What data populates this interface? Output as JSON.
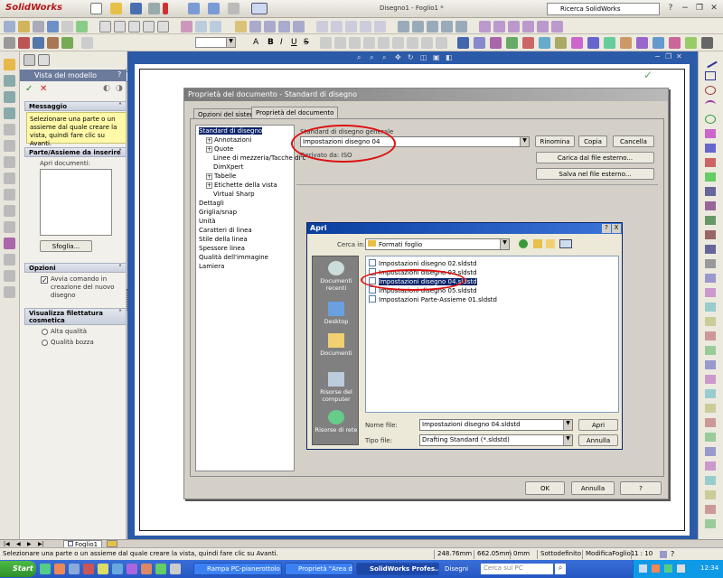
{
  "app": {
    "logo": "SolidWorks",
    "doc_title": "Disegno1 - Foglio1 *",
    "search_placeholder": "Ricerca SolidWorks"
  },
  "property_manager": {
    "tab_title": "Vista del modello",
    "message_header": "Messaggio",
    "message_text": "Selezionare una parte o un assieme dal quale creare la vista, quindi fare clic su Avanti.",
    "insert_header": "Parte/Assieme da inserire",
    "open_docs_label": "Apri documenti:",
    "browse_button": "Sfoglia...",
    "options_header": "Opzioni",
    "option_checkbox": "Avvia comando in creazione del nuovo disegno",
    "thread_header": "Visualizza filettatura cosmetica",
    "radio_high": "Alta qualità",
    "radio_draft": "Qualità bozza"
  },
  "doc_props_dialog": {
    "title": "Proprietà del documento - Standard di disegno",
    "tabs": [
      "Opzioni del sistema",
      "Proprietà del documento"
    ],
    "tree": [
      {
        "label": "Standard di disegno",
        "level": 0,
        "selected": true
      },
      {
        "label": "Annotazioni",
        "level": 1,
        "expander": "+"
      },
      {
        "label": "Quote",
        "level": 1,
        "expander": "+"
      },
      {
        "label": "Linee di mezzeria/Tacche di c",
        "level": 2
      },
      {
        "label": "DimXpert",
        "level": 2
      },
      {
        "label": "Tabelle",
        "level": 1,
        "expander": "+"
      },
      {
        "label": "Etichette della vista",
        "level": 1,
        "expander": "+"
      },
      {
        "label": "Virtual Sharp",
        "level": 2
      },
      {
        "label": "Dettagli",
        "level": 0
      },
      {
        "label": "Griglia/snap",
        "level": 0
      },
      {
        "label": "Unità",
        "level": 0
      },
      {
        "label": "Caratteri di linea",
        "level": 0
      },
      {
        "label": "Stile della linea",
        "level": 0
      },
      {
        "label": "Spessore linea",
        "level": 0
      },
      {
        "label": "Qualità dell'immagine",
        "level": 0
      },
      {
        "label": "Lamiera",
        "level": 0
      }
    ],
    "standard_label": "Standard di disegno generale",
    "standard_value": "Impostazioni disegno 04",
    "derived_label": "Derivato da: ISO",
    "rename_button": "Rinomina",
    "copy_button": "Copia",
    "delete_button": "Cancella",
    "load_button": "Carica dal file esterno...",
    "save_button": "Salva nel file esterno...",
    "ok_button": "OK",
    "cancel_button": "Annulla",
    "help_button": "?"
  },
  "open_dialog": {
    "title": "Apri",
    "help": "?",
    "close": "X",
    "look_in_label": "Cerca in:",
    "look_in_value": "Formati foglio",
    "places": [
      "Documenti recenti",
      "Desktop",
      "Documenti",
      "Risorse del computer",
      "Risorse di rete"
    ],
    "files": [
      "Impostazioni disegno 02.sldstd",
      "Impostazioni disegno 03.sldstd",
      "Impostazioni disegno 04.sldstd",
      "Impostazioni disegno 05.sldstd",
      "Impostazioni Parte-Assieme 01.sldstd"
    ],
    "filename_label": "Nome file:",
    "filename_value": "Impostazioni disegno 04.sldstd",
    "filetype_label": "Tipo file:",
    "filetype_value": "Drafting Standard (*.sldstd)",
    "open_button": "Apri",
    "cancel_button": "Annulla"
  },
  "sheet_tab": "Foglio1",
  "status": {
    "message": "Selezionare una parte o un assieme dal quale creare la vista, quindi fare clic su Avanti.",
    "x": "248.76mm",
    "y": "662.05mm",
    "z": "0mm",
    "state": "Sottodefinito",
    "mode": "ModificaFoglio1",
    "scale": "1 : 10"
  },
  "taskbar": {
    "start": "Start",
    "tasks": [
      "Rampa PC-pianerottolo",
      "Proprietà \"Area di su...",
      "SolidWorks Profes..."
    ],
    "folder": "Disegni",
    "search": "Cerca sul PC",
    "clock": "12:34"
  },
  "colors": {
    "canvas_bg": "#2b5aa8",
    "highlight": "#0a246a",
    "annotation_red": "#d11111"
  }
}
